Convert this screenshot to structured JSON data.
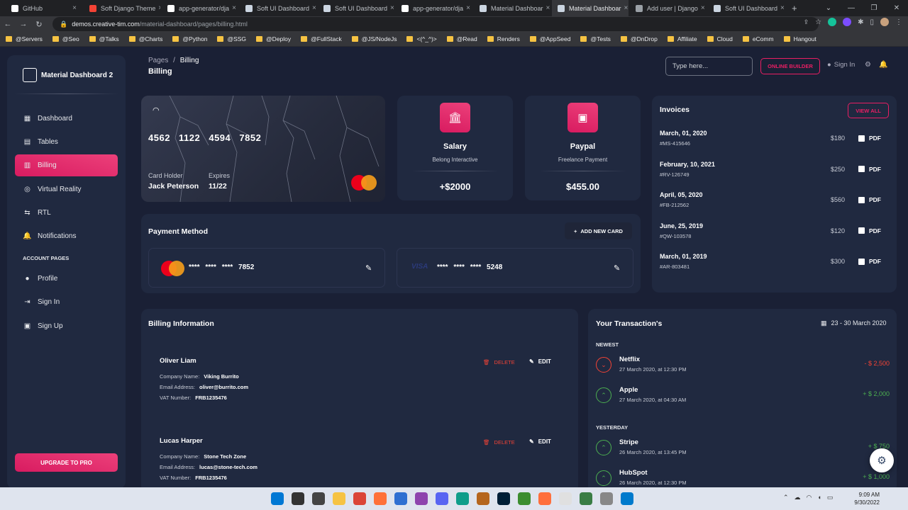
{
  "browser": {
    "tabs": [
      {
        "label": "GitHub",
        "color": "#ffffff"
      },
      {
        "label": "Soft Django Theme",
        "color": "#f44335"
      },
      {
        "label": "app-generator/dja",
        "color": "#ffffff"
      },
      {
        "label": "Soft UI Dashboard",
        "color": "#cbd5e1"
      },
      {
        "label": "Soft UI Dashboard",
        "color": "#cbd5e1"
      },
      {
        "label": "app-generator/dja",
        "color": "#ffffff"
      },
      {
        "label": "Material Dashboar",
        "color": "#cbd5e1"
      },
      {
        "label": "Material Dashboar",
        "color": "#cbd5e1"
      },
      {
        "label": "Add user | Django",
        "color": "#9aa0a6"
      },
      {
        "label": "Soft UI Dashboard",
        "color": "#cbd5e1"
      }
    ],
    "url_host": "demos.creative-tim.com",
    "url_path": "/material-dashboard/pages/billing.html",
    "bookmarks": [
      "@Servers",
      "@Seo",
      "@Talks",
      "@Charts",
      "@Python",
      "@SSG",
      "@Deploy",
      "@FullStack",
      "@JS/NodeJs",
      "<(^_^)>",
      "@Read",
      "Renders",
      "@AppSeed",
      "@Tests",
      "@DnDrop",
      "Affiliate",
      "Cloud",
      "eComm",
      "Hangout"
    ]
  },
  "sidebar": {
    "brand": "Material Dashboard 2",
    "items": [
      {
        "label": "Dashboard",
        "icon": "dashboard-icon",
        "glyph": "▦"
      },
      {
        "label": "Tables",
        "icon": "table-icon",
        "glyph": "▤"
      },
      {
        "label": "Billing",
        "icon": "receipt-icon",
        "glyph": "▥"
      },
      {
        "label": "Virtual Reality",
        "icon": "vr-icon",
        "glyph": "◎"
      },
      {
        "label": "RTL",
        "icon": "rtl-icon",
        "glyph": "⇆"
      },
      {
        "label": "Notifications",
        "icon": "bell-icon",
        "glyph": "🔔"
      }
    ],
    "account_heading": "ACCOUNT PAGES",
    "account_items": [
      {
        "label": "Profile",
        "icon": "person-icon",
        "glyph": "●"
      },
      {
        "label": "Sign In",
        "icon": "login-icon",
        "glyph": "⇥"
      },
      {
        "label": "Sign Up",
        "icon": "assignment-icon",
        "glyph": "▣"
      }
    ],
    "upgrade": "UPGRADE TO PRO"
  },
  "topbar": {
    "crumb_root": "Pages",
    "crumb_sep": "/",
    "crumb_current": "Billing",
    "title": "Billing",
    "search_placeholder": "Type here...",
    "builder": "ONLINE BUILDER",
    "signin": "Sign In"
  },
  "credit_card": {
    "number": "4562 1122 4594 7852",
    "holder_label": "Card Holder",
    "holder": "Jack Peterson",
    "expires_label": "Expires",
    "expires": "11/22"
  },
  "salary": {
    "title": "Salary",
    "subtitle": "Belong Interactive",
    "amount": "+$2000"
  },
  "paypal": {
    "title": "Paypal",
    "subtitle": "Freelance Payment",
    "amount": "$455.00"
  },
  "invoices": {
    "title": "Invoices",
    "view_all": "VIEW ALL",
    "pdf_label": "PDF",
    "rows": [
      {
        "date": "March, 01, 2020",
        "id": "#MS-415646",
        "amount": "$180"
      },
      {
        "date": "February, 10, 2021",
        "id": "#RV-126749",
        "amount": "$250"
      },
      {
        "date": "April, 05, 2020",
        "id": "#FB-212562",
        "amount": "$560"
      },
      {
        "date": "June, 25, 2019",
        "id": "#QW-103578",
        "amount": "$120"
      },
      {
        "date": "March, 01, 2019",
        "id": "#AR-803481",
        "amount": "$300"
      }
    ]
  },
  "payment_method": {
    "title": "Payment Method",
    "add": "ADD NEW CARD",
    "cards": [
      {
        "number": "**** **** **** 7852",
        "brand": "mastercard"
      },
      {
        "number": "**** **** **** 5248",
        "brand": "VISA"
      }
    ]
  },
  "billing_info": {
    "title": "Billing Information",
    "company_label": "Company Name:",
    "email_label": "Email Address:",
    "vat_label": "VAT Number:",
    "delete": "DELETE",
    "edit": "EDIT",
    "rows": [
      {
        "name": "Oliver Liam",
        "company": "Viking Burrito",
        "email": "oliver@burrito.com",
        "vat": "FRB1235476"
      },
      {
        "name": "Lucas Harper",
        "company": "Stone Tech Zone",
        "email": "lucas@stone-tech.com",
        "vat": "FRB1235476"
      }
    ]
  },
  "transactions": {
    "title": "Your Transaction's",
    "range": "23 - 30 March 2020",
    "newest": "NEWEST",
    "yesterday": "YESTERDAY",
    "newest_rows": [
      {
        "name": "Netflix",
        "time": "27 March 2020, at 12:30 PM",
        "amount": "- $ 2,500",
        "kind": "neg"
      },
      {
        "name": "Apple",
        "time": "27 March 2020, at 04:30 AM",
        "amount": "+ $ 2,000",
        "kind": "pos"
      }
    ],
    "yesterday_rows": [
      {
        "name": "Stripe",
        "time": "26 March 2020, at 13:45 PM",
        "amount": "+ $ 750",
        "kind": "pos"
      },
      {
        "name": "HubSpot",
        "time": "26 March 2020, at 12:30 PM",
        "amount": "+ $ 1,000",
        "kind": "pos"
      }
    ]
  },
  "taskbar": {
    "time": "9:09 AM",
    "date": "9/30/2022"
  }
}
